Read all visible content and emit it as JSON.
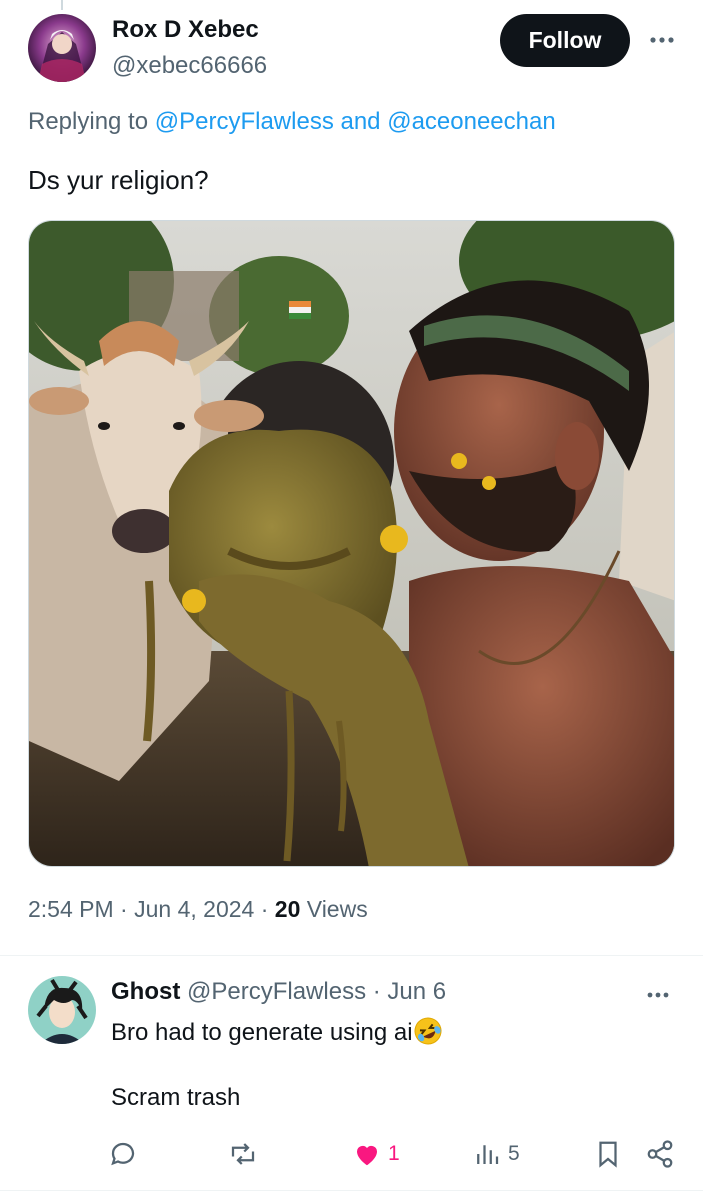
{
  "tweet": {
    "author_name": "Rox D Xebec",
    "author_handle": "@xebec66666",
    "follow_label": "Follow",
    "replying_prefix": "Replying to",
    "mention_1": "@PercyFlawless",
    "mention_joiner": "and",
    "mention_2": "@aceoneechan",
    "text": "Ds yur religion?",
    "time": "2:54 PM",
    "date": "Jun 4, 2024",
    "views_count": "20",
    "views_label": "Views"
  },
  "reply": {
    "author_name": "Ghost",
    "author_handle": "@PercyFlawless",
    "date": "Jun 6",
    "line1": "Bro had to generate using ai",
    "emoji": "rolling-on-floor-laughing",
    "line2": "Scram trash",
    "actions": {
      "reply_count": "",
      "retweet_count": "",
      "like_count": "1",
      "views_count": "5"
    }
  },
  "colors": {
    "text": "#0f1419",
    "secondary": "#536471",
    "link": "#1d9bf0",
    "like": "#f91880",
    "button": "#0f1419"
  },
  "icons": [
    "more-icon",
    "reply-icon",
    "retweet-icon",
    "heart-icon",
    "views-icon",
    "bookmark-icon",
    "share-icon"
  ]
}
